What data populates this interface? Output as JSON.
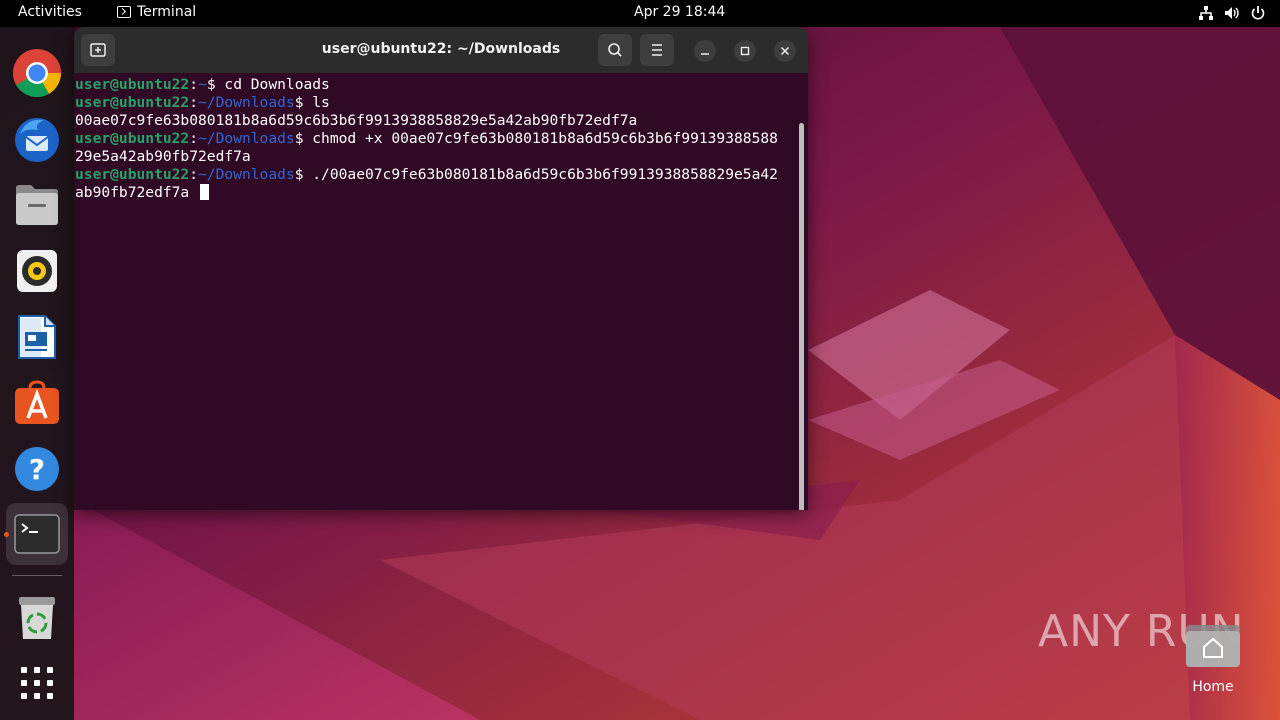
{
  "topbar": {
    "activities": "Activities",
    "app_name": "Terminal",
    "clock": "Apr 29  18:44",
    "tray_icons": [
      "network-icon",
      "volume-icon",
      "power-icon"
    ]
  },
  "dock": {
    "items": [
      {
        "name": "chrome-icon"
      },
      {
        "name": "thunderbird-icon"
      },
      {
        "name": "files-icon"
      },
      {
        "name": "rhythmbox-icon"
      },
      {
        "name": "libreoffice-writer-icon"
      },
      {
        "name": "app-center-icon"
      },
      {
        "name": "help-icon"
      },
      {
        "name": "terminal-icon",
        "active": true
      },
      {
        "name": "trash-icon"
      },
      {
        "name": "show-apps-icon"
      }
    ]
  },
  "terminal": {
    "title": "user@ubuntu22: ~/Downloads",
    "lines": [
      {
        "user": "user@ubuntu22",
        "sep": ":",
        "path": "~",
        "prompt": "$ ",
        "cmd": "cd Downloads"
      },
      {
        "user": "user@ubuntu22",
        "sep": ":",
        "path": "~/Downloads",
        "prompt": "$ ",
        "cmd": "ls"
      },
      {
        "output": "00ae07c9fe63b080181b8a6d59c6b3b6f9913938858829e5a42ab90fb72edf7a"
      },
      {
        "user": "user@ubuntu22",
        "sep": ":",
        "path": "~/Downloads",
        "prompt": "$ ",
        "cmd": "chmod +x 00ae07c9fe63b080181b8a6d59c6b3b6f99139388588"
      },
      {
        "output": "29e5a42ab90fb72edf7a"
      },
      {
        "user": "user@ubuntu22",
        "sep": ":",
        "path": "~/Downloads",
        "prompt": "$ ",
        "cmd": "./00ae07c9fe63b080181b8a6d59c6b3b6f9913938858829e5a42"
      },
      {
        "output": "ab90fb72edf7a ",
        "cursor": true
      }
    ]
  },
  "desktop": {
    "watermark": "ANY RUN",
    "home_label": "Home"
  },
  "colors": {
    "terminal_bg": "#300a24",
    "prompt_user": "#26a269",
    "prompt_path": "#3465d1",
    "accent": "#e95420"
  }
}
